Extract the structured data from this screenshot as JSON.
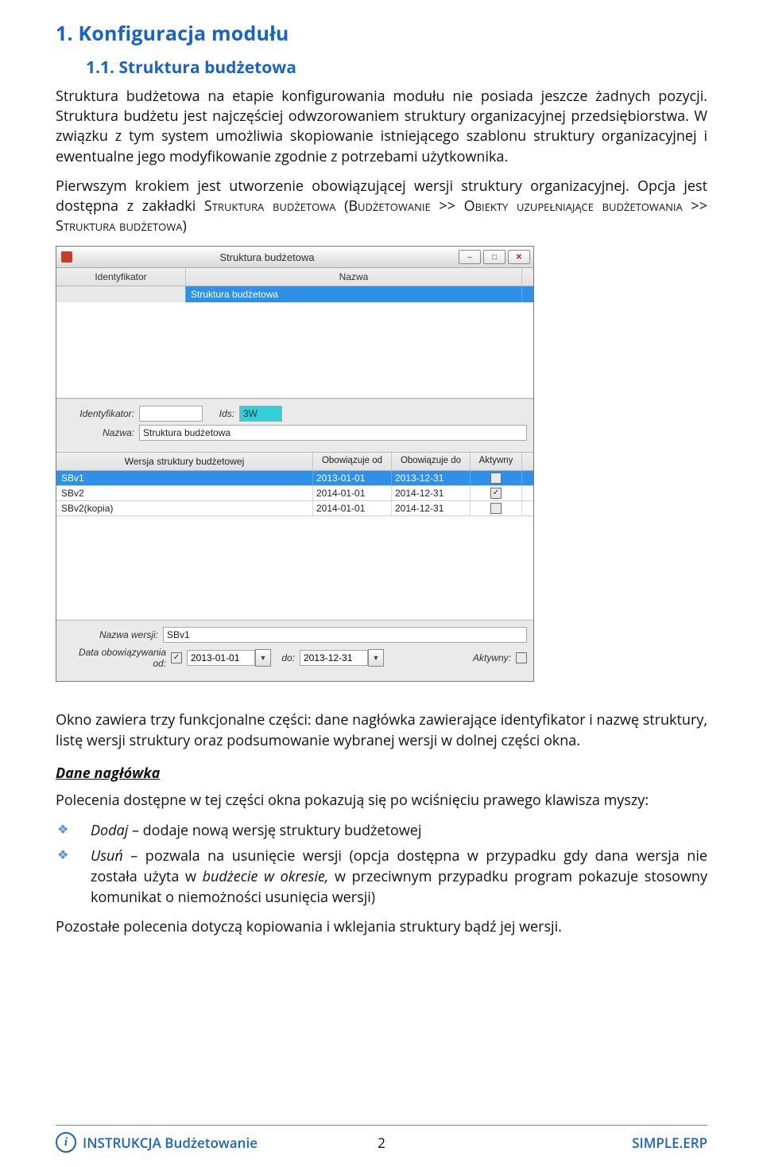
{
  "doc": {
    "h1": "1. Konfiguracja modułu",
    "h2": "1.1. Struktura budżetowa",
    "p1": "Struktura budżetowa na etapie konfigurowania modułu nie posiada jeszcze żadnych pozycji. Struktura budżetu jest najczęściej odwzorowaniem struktury organizacyjnej przedsiębiorstwa. W związku z tym system umożliwia skopiowanie istniejącego szablonu struktury organizacyjnej i ewentualne jego modyfikowanie zgodnie z potrzebami użytkownika.",
    "p2a": "Pierwszym krokiem jest utworzenie obowiązującej wersji struktury organizacyjnej. Opcja jest dostępna z zakładki ",
    "p2_sc1": "Struktura budżetowa (Budżetowanie >> Obiekty uzupełniające budżetowania >> Struktura budżetowa)",
    "p3": "Okno zawiera trzy funkcjonalne części: dane nagłówka zawierające identyfikator i nazwę struktury, listę wersji struktury oraz podsumowanie wybranej wersji w dolnej części okna.",
    "subhead1": "Dane nagłówka",
    "p4": "Polecenia dostępne w tej części okna pokazują się po wciśnięciu prawego klawisza myszy:",
    "b1_cmd": "Dodaj",
    "b1_rest": " – dodaje nową wersję struktury budżetowej",
    "b2_cmd": "Usuń",
    "b2_rest": " – pozwala na usunięcie wersji (opcja dostępna w przypadku gdy dana wersja nie została użyta w ",
    "b2_it": "budżecie w okresie,",
    "b2_rest2": " w przeciwnym przypadku program pokazuje stosowny komunikat o niemożności usunięcia wersji)",
    "p5": "Pozostałe polecenia dotyczą kopiowania i wklejania struktury bądź jej wersji."
  },
  "footer": {
    "left": "INSTRUKCJA Budżetowanie",
    "center": "2",
    "right": "SIMPLE.ERP"
  },
  "app": {
    "window_title": "Struktura budżetowa",
    "columns_top": {
      "identyfikator": "Identyfikator",
      "nazwa": "Nazwa"
    },
    "top_row": {
      "identyfikator": "",
      "nazwa": "Struktura budżetowa"
    },
    "mid": {
      "label_ident": "Identyfikator:",
      "val_ident": "",
      "label_ids": "Ids:",
      "val_ids": "3W",
      "label_nazwa": "Nazwa:",
      "val_nazwa": "Struktura budżetowa"
    },
    "columns_ver": {
      "name": "Wersja struktury budżetowej",
      "from": "Obowiązuje od",
      "to": "Obowiązuje do",
      "active": "Aktywny"
    },
    "versions": [
      {
        "name": "SBv1",
        "from": "2013-01-01",
        "to": "2013-12-31",
        "active": false,
        "selected": true
      },
      {
        "name": "SBv2",
        "from": "2014-01-01",
        "to": "2014-12-31",
        "active": true,
        "selected": false
      },
      {
        "name": "SBv2(kopia)",
        "from": "2014-01-01",
        "to": "2014-12-31",
        "active": false,
        "selected": false
      }
    ],
    "bottom": {
      "label_nazwa": "Nazwa wersji:",
      "val_nazwa": "SBv1",
      "label_data_from": "Data obowiązywania od:",
      "chk_from": true,
      "val_from": "2013-01-01",
      "label_do": "do:",
      "val_to": "2013-12-31",
      "label_aktywny": "Aktywny:",
      "chk_aktywny": false
    }
  }
}
